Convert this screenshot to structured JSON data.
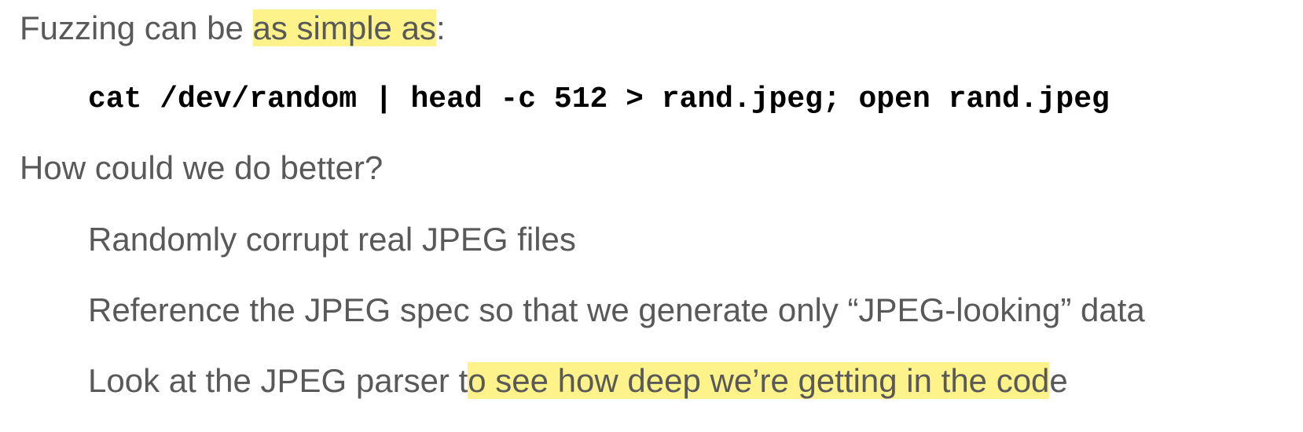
{
  "intro": {
    "before": "Fuzzing can be ",
    "highlight": "as simple as",
    "after": ":"
  },
  "command": "cat /dev/random | head -c 512 > rand.jpeg; open rand.jpeg",
  "question": "How could we do better?",
  "bullets": [
    {
      "text": "Randomly corrupt real JPEG files"
    },
    {
      "text": "Reference the JPEG spec so that we generate only “JPEG-looking” data"
    },
    {
      "before": "Look at the JPEG parser t",
      "highlight": "o see how deep we’re getting in the cod",
      "after": "e"
    }
  ],
  "highlight_color": "#fef28a",
  "text_color": "#595959",
  "code_color": "#000000"
}
